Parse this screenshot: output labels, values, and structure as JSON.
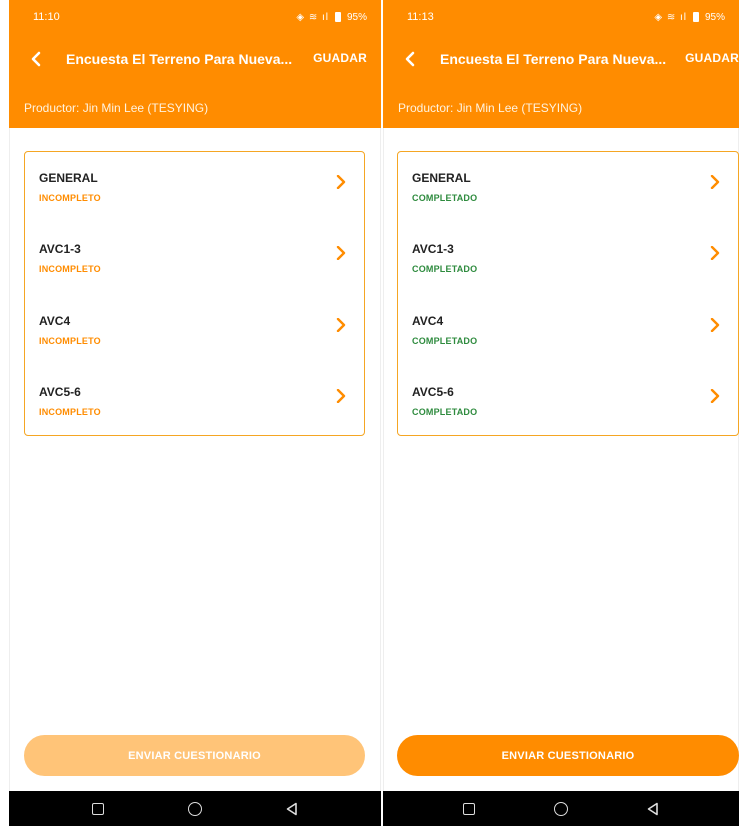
{
  "colors": {
    "brand": "#ff8c00",
    "incomplete": "#ff8c00",
    "complete": "#2e8b3e",
    "submit_disabled": "#ffc478"
  },
  "screens": [
    {
      "status_bar": {
        "time": "11:10",
        "battery": "95%"
      },
      "app_bar": {
        "back_icon": "chevron-left-icon",
        "title": "Encuesta El Terreno Para Nueva...",
        "save_label": "GUADAR",
        "producer": "Productor: Jin Min Lee (TESYING)"
      },
      "sections": [
        {
          "name": "GENERAL",
          "status": "INCOMPLETO"
        },
        {
          "name": "AVC1-3",
          "status": "INCOMPLETO"
        },
        {
          "name": "AVC4",
          "status": "INCOMPLETO"
        },
        {
          "name": "AVC5-6",
          "status": "INCOMPLETO"
        }
      ],
      "submit_label": "ENVIAR CUESTIONARIO",
      "submit_enabled": false
    },
    {
      "status_bar": {
        "time": "11:13",
        "battery": "95%"
      },
      "app_bar": {
        "back_icon": "chevron-left-icon",
        "title": "Encuesta El Terreno Para Nueva...",
        "save_label": "GUADAR",
        "producer": "Productor: Jin Min Lee (TESYING)"
      },
      "sections": [
        {
          "name": "GENERAL",
          "status": "COMPLETADO"
        },
        {
          "name": "AVC1-3",
          "status": "COMPLETADO"
        },
        {
          "name": "AVC4",
          "status": "COMPLETADO"
        },
        {
          "name": "AVC5-6",
          "status": "COMPLETADO"
        }
      ],
      "submit_label": "ENVIAR CUESTIONARIO",
      "submit_enabled": true
    }
  ]
}
